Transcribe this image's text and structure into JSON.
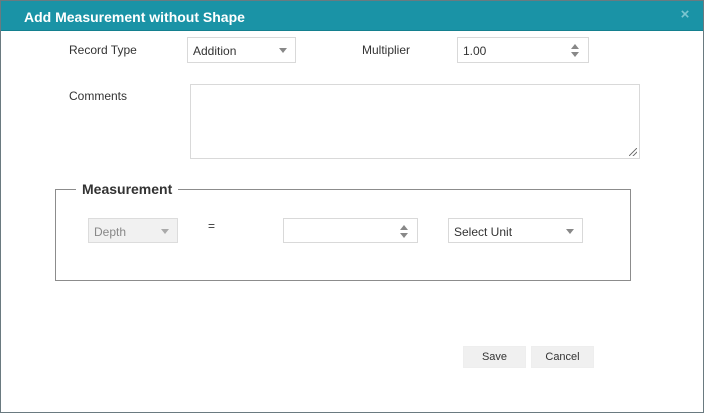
{
  "dialog": {
    "title": "Add Measurement without Shape",
    "close_symbol": "×"
  },
  "form": {
    "record_type_label": "Record Type",
    "record_type_value": "Addition",
    "multiplier_label": "Multiplier",
    "multiplier_value": "1.00",
    "comments_label": "Comments",
    "comments_value": ""
  },
  "measurement": {
    "legend": "Measurement",
    "dimension_value": "Depth",
    "equals": "=",
    "amount_value": "",
    "unit_value": "Select Unit"
  },
  "buttons": {
    "save": "Save",
    "cancel": "Cancel"
  },
  "colors": {
    "titlebar": "#1a93a6",
    "title_text": "#ffffff"
  }
}
